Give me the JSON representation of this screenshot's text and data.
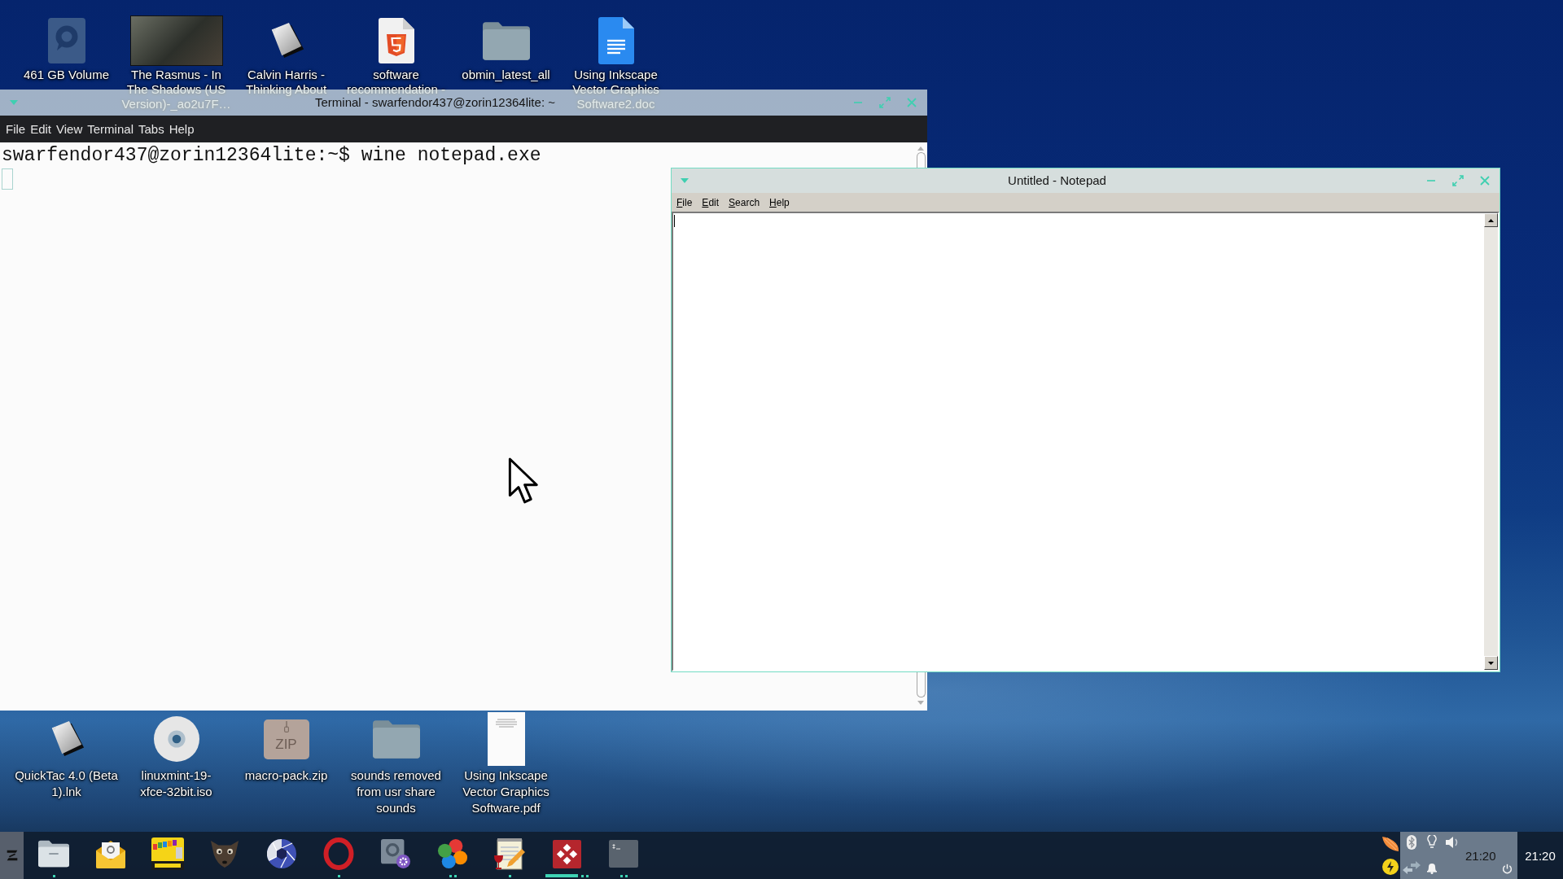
{
  "desktop": {
    "top_icons": [
      {
        "kind": "drive",
        "label": "461 GB Volume"
      },
      {
        "kind": "video",
        "label": "The Rasmus - In\nThe Shadows (US\nVersion)-_ao2u7F…"
      },
      {
        "kind": "shortcut",
        "label": "Calvin Harris -\nThinking About"
      },
      {
        "kind": "html",
        "label": "software\nrecommendation -"
      },
      {
        "kind": "folder",
        "label": "obmin_latest_all"
      },
      {
        "kind": "document",
        "label": "Using Inkscape\nVector Graphics\nSoftware2.doc"
      }
    ],
    "bottom_icons": [
      {
        "kind": "shortcut",
        "label": "QuickTac 4.0 (Beta\n1).lnk"
      },
      {
        "kind": "disc",
        "label": "linuxmint-19-\nxfce-32bit.iso"
      },
      {
        "kind": "archive",
        "badge": "ZIP",
        "label": "macro-pack.zip"
      },
      {
        "kind": "folder",
        "label": "sounds removed\nfrom usr share\nsounds"
      },
      {
        "kind": "page",
        "label": "Using Inkscape\nVector Graphics\nSoftware.pdf"
      }
    ]
  },
  "terminal": {
    "title": "Terminal - swarfendor437@zorin12364lite: ~",
    "menu": [
      "File",
      "Edit",
      "View",
      "Terminal",
      "Tabs",
      "Help"
    ],
    "lines": [
      "swarfendor437@zorin12364lite:~$ wine notepad.exe"
    ]
  },
  "notepad": {
    "title": "Untitled - Notepad",
    "menu": [
      "File",
      "Edit",
      "Search",
      "Help"
    ]
  },
  "taskbar": {
    "apps": [
      {
        "kind": "folder",
        "running": true,
        "multiple": false,
        "selected": false
      },
      {
        "kind": "mail",
        "running": false,
        "multiple": false,
        "selected": false
      },
      {
        "kind": "multiboot",
        "running": false,
        "multiple": false,
        "selected": false
      },
      {
        "kind": "creature",
        "running": false,
        "multiple": false,
        "selected": false
      },
      {
        "kind": "shutter",
        "running": false,
        "multiple": false,
        "selected": false
      },
      {
        "kind": "ring",
        "running": true,
        "multiple": false,
        "selected": false
      },
      {
        "kind": "disk",
        "running": false,
        "multiple": false,
        "selected": false
      },
      {
        "kind": "clover",
        "running": true,
        "multiple": true,
        "selected": false
      },
      {
        "kind": "notepad",
        "running": true,
        "multiple": false,
        "selected": false
      },
      {
        "kind": "diamond",
        "running": true,
        "multiple": true,
        "selected": true
      },
      {
        "kind": "terminal",
        "running": true,
        "multiple": true,
        "selected": false
      }
    ],
    "tray": {
      "time": "21:20"
    },
    "clock": "21:20"
  }
}
